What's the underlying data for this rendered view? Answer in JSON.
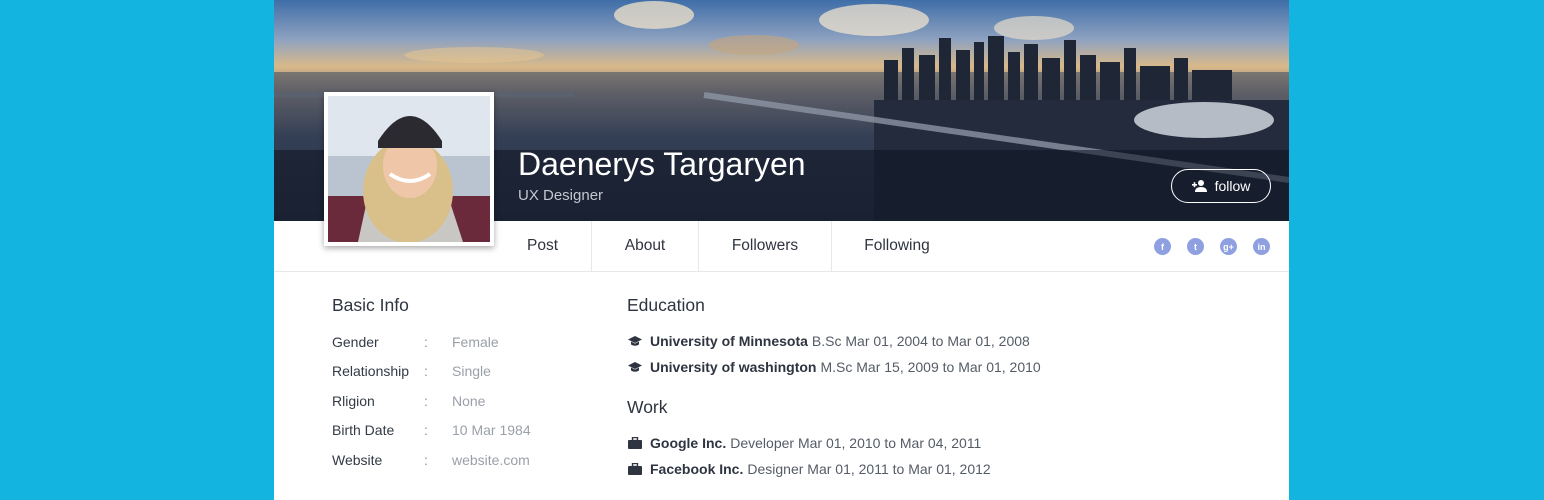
{
  "profile": {
    "name": "Daenerys Targaryen",
    "role": "UX Designer",
    "follow_label": "follow"
  },
  "tabs": [
    "Post",
    "About",
    "Followers",
    "Following"
  ],
  "social": [
    {
      "icon": "facebook-icon",
      "glyph": "f"
    },
    {
      "icon": "twitter-icon",
      "glyph": "t"
    },
    {
      "icon": "google-plus-icon",
      "glyph": "g+"
    },
    {
      "icon": "linkedin-icon",
      "glyph": "in"
    }
  ],
  "basic_info": {
    "title": "Basic Info",
    "rows": [
      {
        "label": "Gender",
        "sep": ":",
        "value": "Female"
      },
      {
        "label": "Relationship",
        "sep": ":",
        "value": "Single"
      },
      {
        "label": "Rligion",
        "sep": ":",
        "value": "None"
      },
      {
        "label": "Birth Date",
        "sep": ":",
        "value": "10 Mar 1984"
      },
      {
        "label": "Website",
        "sep": ":",
        "value": "website.com"
      }
    ]
  },
  "education": {
    "title": "Education",
    "items": [
      {
        "name": "University of Minnesota",
        "detail": "B.Sc Mar 01, 2004 to Mar 01, 2008"
      },
      {
        "name": "University of washington",
        "detail": "M.Sc Mar 15, 2009 to Mar 01, 2010"
      }
    ]
  },
  "work": {
    "title": "Work",
    "items": [
      {
        "name": "Google Inc.",
        "detail": "Developer Mar 01, 2010 to Mar 04, 2011"
      },
      {
        "name": "Facebook Inc.",
        "detail": "Designer Mar 01, 2011 to Mar 01, 2012"
      }
    ]
  },
  "colors": {
    "page_background": "#14b4e0",
    "social_icon": "#8ea0e0",
    "heading_text": "#2e3440",
    "muted_text": "#9aa0a8"
  }
}
